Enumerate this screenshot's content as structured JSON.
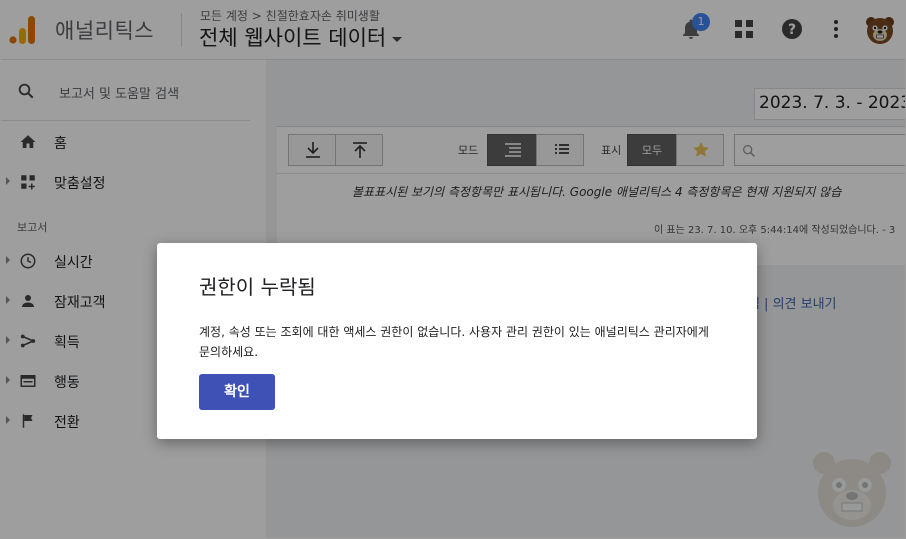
{
  "header": {
    "app_name": "애널리틱스",
    "breadcrumb": "모든 계정 > 친절한효자손 취미생활",
    "view_title": "전체 웹사이트 데이터",
    "notification_count": "1",
    "icons": [
      "analytics-logo-icon",
      "bell-icon",
      "apps-grid-icon",
      "help-icon",
      "more-vert-icon",
      "avatar-bear"
    ]
  },
  "sidebar": {
    "search_placeholder": "보고서 및 도움말 검색",
    "home": "홈",
    "customization": "맞춤설정",
    "section_reports": "보고서",
    "items": [
      {
        "label": "실시간",
        "icon": "clock-icon"
      },
      {
        "label": "잠재고객",
        "icon": "person-icon"
      },
      {
        "label": "획득",
        "icon": "acquisition-icon"
      },
      {
        "label": "행동",
        "icon": "behavior-icon"
      },
      {
        "label": "전환",
        "icon": "flag-icon"
      }
    ]
  },
  "main": {
    "date_range": "2023. 7. 3. - 2023.",
    "mode_label": "모드",
    "display_label": "표시",
    "display_all": "모두",
    "notice": "볼표표시된 보기의 측정항목만 표시됩니다. Google 애널리틱스 4 측정항목은 현재 지원되지 않습",
    "created": "이 표는 23. 7. 10. 오후 5:44:14에 작성되었습니다. - 3",
    "feedback": "방침 | 의견 보내기"
  },
  "dialog": {
    "title": "권한이 누락됨",
    "message": "계정, 속성 또는 조회에 대한 액세스 권한이 없습니다. 사용자 관리 권한이 있는 애널리틱스 관리자에게 문의하세요.",
    "confirm": "확인"
  },
  "colors": {
    "accent_button": "#3f51b5",
    "notification_badge": "#4285f4",
    "logo_orange": "#f9ab00",
    "logo_dark_orange": "#e37400"
  }
}
